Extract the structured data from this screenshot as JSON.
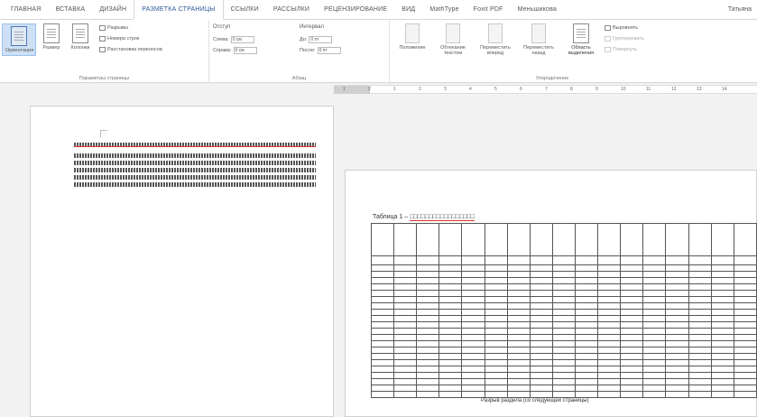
{
  "tabs": [
    "ГЛАВНАЯ",
    "ВСТАВКА",
    "ДИЗАЙН",
    "РАЗМЕТКА СТРАНИЦЫ",
    "ССЫЛКИ",
    "РАССЫЛКИ",
    "РЕЦЕНЗИРОВАНИЕ",
    "ВИД",
    "MathType",
    "Foxit PDF",
    "Меньшикова"
  ],
  "active_tab": "РАЗМЕТКА СТРАНИЦЫ",
  "user": "Татьяна",
  "ribbon": {
    "page_setup": {
      "label": "Параметры страницы",
      "orientation": "Ориентация",
      "size": "Размер",
      "columns": "Колонки",
      "breaks": "Разрывы",
      "line_numbers": "Номера строк",
      "hyphenation": "Расстановка переносов"
    },
    "paragraph": {
      "label": "Абзац",
      "indent_header": "Отступ",
      "spacing_header": "Интервал",
      "left_label": "Слева:",
      "left_value": "0 см",
      "right_label": "Справа:",
      "right_value": "0 см",
      "before_label": "До:",
      "before_value": "0 пт",
      "after_label": "После:",
      "after_value": "0 пт"
    },
    "arrange": {
      "label": "Упорядочение",
      "position": "Положение",
      "wrap": "Обтекание текстом",
      "forward": "Переместить вперед",
      "backward": "Переместить назад",
      "selection_pane": "Область выделения",
      "align": "Выровнять",
      "group": "Группировать",
      "rotate": "Повернуть"
    }
  },
  "ruler": {
    "ticks": [
      "1",
      "2",
      "1",
      "2",
      "3",
      "4",
      "5",
      "6",
      "7",
      "8",
      "9",
      "10",
      "11",
      "12",
      "13",
      "14"
    ]
  },
  "document": {
    "caption_label": "Таблица 1 –",
    "footer_text": "Разрыв раздела (со следующей страницы)"
  },
  "colors": {
    "accent": "#2b579a",
    "spell_red": "#dd3333"
  }
}
